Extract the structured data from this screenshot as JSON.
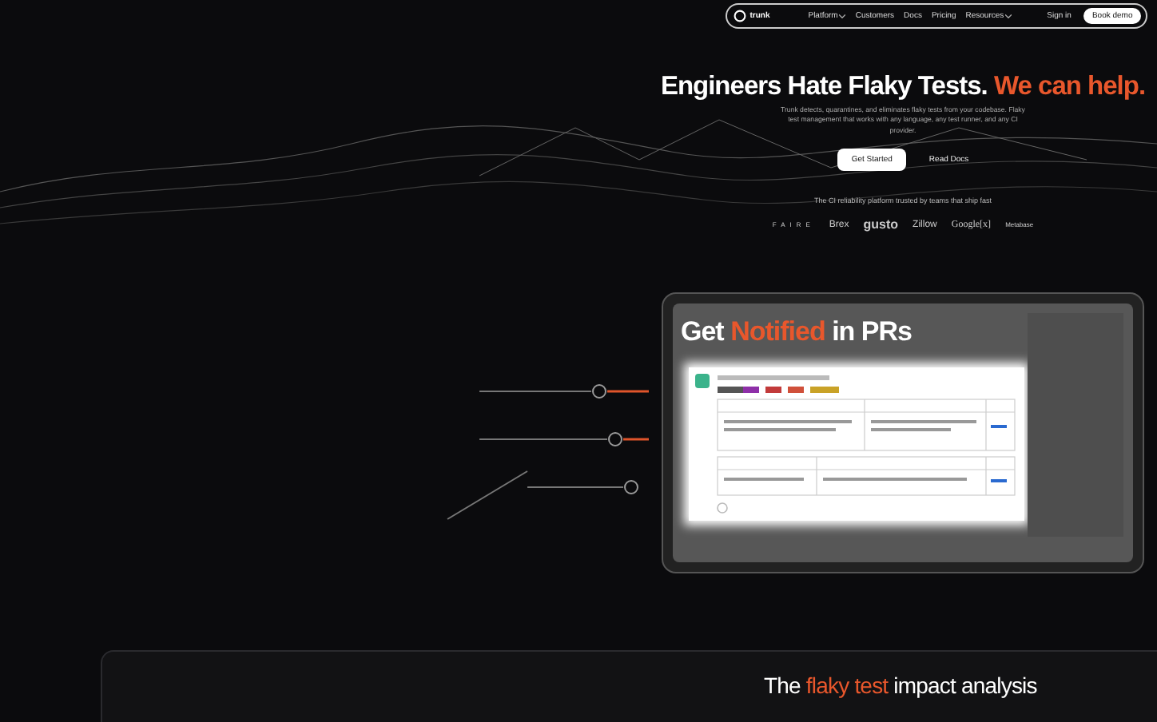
{
  "nav": {
    "logo": "trunk",
    "links": [
      {
        "label": "Platform",
        "dropdown": true
      },
      {
        "label": "Customers",
        "dropdown": false
      },
      {
        "label": "Docs",
        "dropdown": false
      },
      {
        "label": "Pricing",
        "dropdown": false
      },
      {
        "label": "Resources",
        "dropdown": true
      }
    ],
    "sign_in": "Sign in",
    "cta": "Book demo"
  },
  "hero": {
    "title": "Engineers Hate Flaky Tests.",
    "title_accent": "We can help.",
    "description": "Trunk detects, quarantines, and eliminates flaky tests from your codebase. Flaky test management that works with any language, any test runner, and any CI provider.",
    "primary_button": "Get Started",
    "secondary_button": "Read Docs"
  },
  "trusted": {
    "caption": "The CI reliability platform trusted by teams that ship fast",
    "logos": [
      "FAIRE",
      "Brex",
      "gusto",
      "Zillow",
      "Google[x]",
      "Metabase"
    ]
  },
  "video": {
    "headline_start": "Get",
    "headline_accent": "Notified",
    "headline_end": "in PRs"
  },
  "impact": {
    "title_start": "The",
    "title_accent": "flaky test",
    "title_end": "impact analysis"
  }
}
